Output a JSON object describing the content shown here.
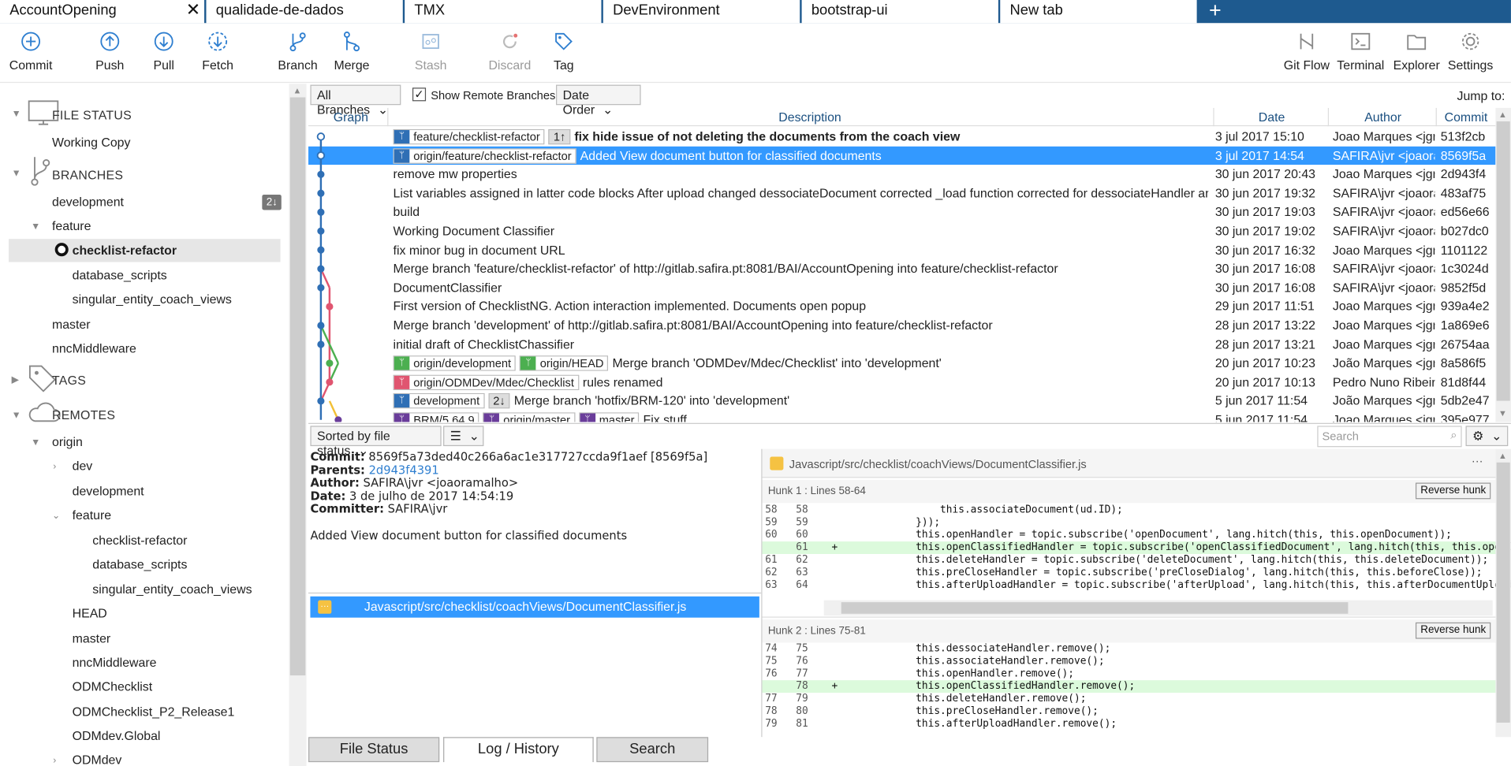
{
  "tabs": [
    "AccountOpening",
    "qualidade-de-dados",
    "TMX",
    "DevEnvironment",
    "bootstrap-ui",
    "New tab"
  ],
  "toolbar": {
    "commit": "Commit",
    "push": "Push",
    "pull": "Pull",
    "fetch": "Fetch",
    "branch": "Branch",
    "merge": "Merge",
    "stash": "Stash",
    "discard": "Discard",
    "tag": "Tag",
    "gitflow": "Git Flow",
    "terminal": "Terminal",
    "explorer": "Explorer",
    "settings": "Settings"
  },
  "sidebar": {
    "file_status": "FILE STATUS",
    "working_copy": "Working Copy",
    "branches": "BRANCHES",
    "development": "development",
    "dev_badge": "2↓",
    "feature": "feature",
    "checklist_refactor": "checklist-refactor",
    "database_scripts": "database_scripts",
    "singular": "singular_entity_coach_views",
    "master": "master",
    "nnc": "nncMiddleware",
    "tags": "TAGS",
    "remotes": "REMOTES",
    "origin": "origin",
    "r": [
      "dev",
      "development",
      "feature",
      "checklist-refactor",
      "database_scripts",
      "singular_entity_coach_views",
      "HEAD",
      "master",
      "nncMiddleware",
      "ODMChecklist",
      "ODMChecklist_P2_Release1",
      "ODMdev.Global",
      "ODMdev"
    ]
  },
  "filter": {
    "branches": "All Branches",
    "show_remote": "Show Remote Branches",
    "order": "Date Order",
    "jump": "Jump to:"
  },
  "columns": {
    "graph": "Graph",
    "description": "Description",
    "date": "Date",
    "author": "Author",
    "commit": "Commit"
  },
  "log": [
    {
      "tags": [
        {
          "t": "feature/checklist-refactor",
          "c": "#2f6fb5"
        },
        {
          "t": "1↑",
          "c": "badge"
        }
      ],
      "desc": "fix hide issue of not deleting the documents from the coach view",
      "bold": true,
      "date": "3 jul 2017 15:10",
      "author": "Joao Marques <jgr",
      "commit": "513f2cb"
    },
    {
      "tags": [
        {
          "t": "origin/feature/checklist-refactor",
          "c": "#2f6fb5"
        }
      ],
      "desc": "Added View document button for classified documents",
      "date": "3 jul 2017 14:54",
      "author": "SAFIRA\\jvr <joaora",
      "commit": "8569f5a",
      "sel": true
    },
    {
      "desc": "remove mw properties",
      "date": "30 jun 2017 20:43",
      "author": "Joao Marques <jgr",
      "commit": "2d943f4"
    },
    {
      "desc": "List variables assigned in latter code blocks After upload changed dessociateDocument corrected _load function corrected for dessociateHandler and associa",
      "date": "30 jun 2017 19:32",
      "author": "SAFIRA\\jvr <joaora",
      "commit": "483af75"
    },
    {
      "desc": "build",
      "date": "30 jun 2017 19:03",
      "author": "SAFIRA\\jvr <joaora",
      "commit": "ed56e66"
    },
    {
      "desc": "Working Document Classifier",
      "date": "30 jun 2017 19:02",
      "author": "SAFIRA\\jvr <joaora",
      "commit": "b027dc0"
    },
    {
      "desc": "fix minor bug in document URL",
      "date": "30 jun 2017 16:32",
      "author": "Joao Marques <jgr",
      "commit": "1101122"
    },
    {
      "desc": "Merge branch 'feature/checklist-refactor' of http://gitlab.safira.pt:8081/BAI/AccountOpening into feature/checklist-refactor",
      "date": "30 jun 2017 16:08",
      "author": "SAFIRA\\jvr <joaora",
      "commit": "1c3024d"
    },
    {
      "desc": "DocumentClassifier",
      "date": "30 jun 2017 16:08",
      "author": "SAFIRA\\jvr <joaora",
      "commit": "9852f5d"
    },
    {
      "desc": "First version of ChecklistNG. Action interaction implemented. Documents open popup",
      "date": "29 jun 2017 11:51",
      "author": "Joao Marques <jgr",
      "commit": "939a4e2"
    },
    {
      "desc": "Merge branch 'development' of http://gitlab.safira.pt:8081/BAI/AccountOpening into feature/checklist-refactor",
      "date": "28 jun 2017 13:22",
      "author": "Joao Marques <jgr",
      "commit": "1a869e6"
    },
    {
      "desc": "initial draft of ChecklistChassifier",
      "date": "28 jun 2017 13:21",
      "author": "Joao Marques <jgr",
      "commit": "26754aa"
    },
    {
      "tags": [
        {
          "t": "origin/development",
          "c": "#4caf50"
        },
        {
          "t": "origin/HEAD",
          "c": "#4caf50"
        }
      ],
      "desc": "Merge branch 'ODMDev/Mdec/Checklist' into 'development'",
      "date": "20 jun 2017 10:23",
      "author": "João Marques <jgr",
      "commit": "8a586f5"
    },
    {
      "tags": [
        {
          "t": "origin/ODMDev/Mdec/Checklist",
          "c": "#e05570"
        }
      ],
      "desc": "rules renamed",
      "date": "20 jun 2017 10:13",
      "author": "Pedro Nuno Ribeir",
      "commit": "81d8f44"
    },
    {
      "tags": [
        {
          "t": "development",
          "c": "#2f6fb5"
        },
        {
          "t": "2↓",
          "c": "badge"
        }
      ],
      "desc": "Merge branch 'hotfix/BRM-120' into 'development'",
      "date": "5 jun 2017 11:54",
      "author": "João Marques <jgr",
      "commit": "5db2e47"
    },
    {
      "tags": [
        {
          "t": "BRM/5.64.9",
          "c": "#6a3d9a"
        },
        {
          "t": "origin/master",
          "c": "#6a3d9a"
        },
        {
          "t": "master",
          "c": "#6a3d9a"
        }
      ],
      "desc": "Fix stuff",
      "date": "5 jun 2017 11:54",
      "author": "Joao Marques <jgr",
      "commit": "395e977"
    }
  ],
  "sort": {
    "label": "Sorted by file status",
    "search": "Search"
  },
  "details": {
    "commit_l": "Commit:",
    "commit": "8569f5a73ded40c266a6ac1e317727ccda9f1aef [8569f5a]",
    "parents_l": "Parents:",
    "parents": "2d943f4391",
    "author_l": "Author:",
    "author": "SAFIRA\\jvr <joaoramalho>",
    "date_l": "Date:",
    "date": "3 de julho de 2017 14:54:19",
    "committer_l": "Committer:",
    "committer": "SAFIRA\\jvr",
    "message": "Added View document button for classified documents"
  },
  "file": "Javascript/src/checklist/coachViews/DocumentClassifier.js",
  "diff": {
    "path": "Javascript/src/checklist/coachViews/DocumentClassifier.js",
    "hunk1": "Hunk 1 : Lines 58-64",
    "hunk2": "Hunk 2 : Lines 75-81",
    "reverse": "Reverse hunk",
    "h1": [
      {
        "a": "58",
        "b": "58",
        "p": "",
        "c": "        this.associateDocument(ud.ID);"
      },
      {
        "a": "59",
        "b": "59",
        "p": "",
        "c": "    }));"
      },
      {
        "a": "60",
        "b": "60",
        "p": "",
        "c": "    this.openHandler = topic.subscribe('openDocument', lang.hitch(this, this.openDocument));"
      },
      {
        "a": "",
        "b": "61",
        "p": "+",
        "c": "    this.openClassifiedHandler = topic.subscribe('openClassifiedDocument', lang.hitch(this, this.openClass",
        "add": true
      },
      {
        "a": "61",
        "b": "62",
        "p": "",
        "c": "    this.deleteHandler = topic.subscribe('deleteDocument', lang.hitch(this, this.deleteDocument));"
      },
      {
        "a": "62",
        "b": "63",
        "p": "",
        "c": "    this.preCloseHandler = topic.subscribe('preCloseDialog', lang.hitch(this, this.beforeClose));"
      },
      {
        "a": "63",
        "b": "64",
        "p": "",
        "c": "    this.afterUploadHandler = topic.subscribe('afterUpload', lang.hitch(this, this.afterDocumentUpload));"
      }
    ],
    "h2": [
      {
        "a": "74",
        "b": "75",
        "p": "",
        "c": "    this.dessociateHandler.remove();"
      },
      {
        "a": "75",
        "b": "76",
        "p": "",
        "c": "    this.associateHandler.remove();"
      },
      {
        "a": "76",
        "b": "77",
        "p": "",
        "c": "    this.openHandler.remove();"
      },
      {
        "a": "",
        "b": "78",
        "p": "+",
        "c": "    this.openClassifiedHandler.remove();",
        "add": true
      },
      {
        "a": "77",
        "b": "79",
        "p": "",
        "c": "    this.deleteHandler.remove();"
      },
      {
        "a": "78",
        "b": "80",
        "p": "",
        "c": "    this.preCloseHandler.remove();"
      },
      {
        "a": "79",
        "b": "81",
        "p": "",
        "c": "    this.afterUploadHandler.remove();"
      }
    ]
  },
  "bottom_tabs": [
    "File Status",
    "Log / History",
    "Search"
  ]
}
